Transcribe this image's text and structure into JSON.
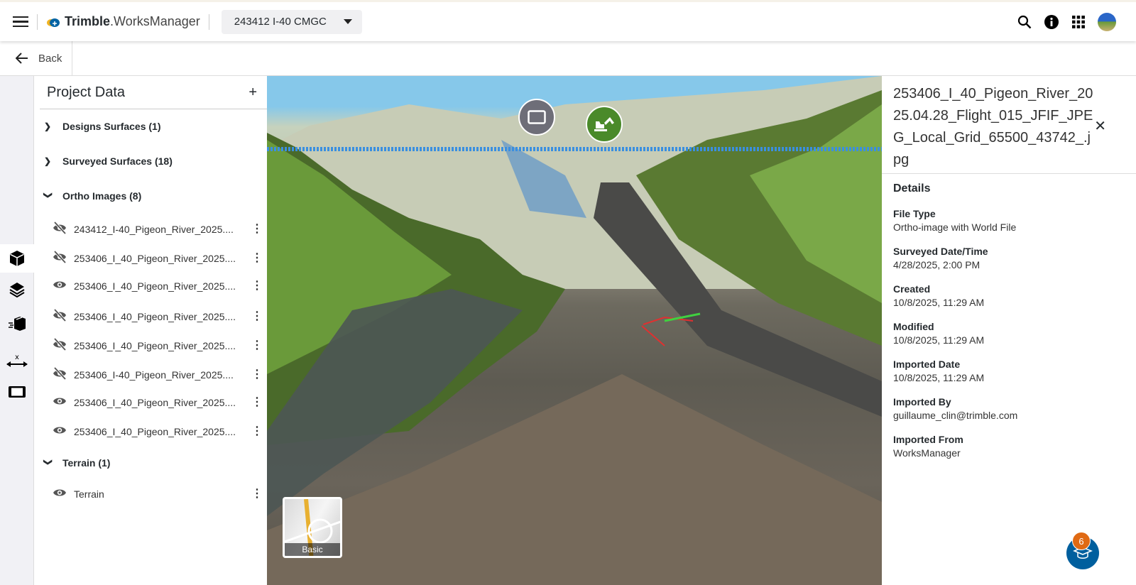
{
  "header": {
    "brand_bold": "Trimble",
    "brand_rest": ".WorksManager",
    "project": "243412 I-40 CMGC"
  },
  "nav": {
    "back": "Back"
  },
  "panel": {
    "title": "Project Data",
    "groups": [
      {
        "label": "Designs Surfaces (1)",
        "expanded": false
      },
      {
        "label": "Surveyed Surfaces (18)",
        "expanded": false
      },
      {
        "label": "Ortho Images (8)",
        "expanded": true
      },
      {
        "label": "Terrain (1)",
        "expanded": true
      }
    ],
    "ortho_items": [
      {
        "label": "243412_I-40_Pigeon_River_2025....",
        "visible": false
      },
      {
        "label": "253406_I_40_Pigeon_River_2025....",
        "visible": false
      },
      {
        "label": "253406_I_40_Pigeon_River_2025....",
        "visible": true
      },
      {
        "label": "253406_I_40_Pigeon_River_2025....",
        "visible": false
      },
      {
        "label": "253406_I_40_Pigeon_River_2025....",
        "visible": false
      },
      {
        "label": "253406_I-40_Pigeon_River_2025....",
        "visible": false
      },
      {
        "label": "253406_I_40_Pigeon_River_2025....",
        "visible": true
      },
      {
        "label": "253406_I_40_Pigeon_River_2025....",
        "visible": true
      }
    ],
    "terrain_items": [
      {
        "label": "Terrain",
        "visible": true
      }
    ]
  },
  "map": {
    "basemap": "Basic"
  },
  "details": {
    "title": "253406_I_40_Pigeon_River_2025.04.28_Flight_015_JFIF_JPEG_Local_Grid_65500_43742_.jpg",
    "heading": "Details",
    "fields": [
      {
        "k": "File Type",
        "v": "Ortho-image with World File"
      },
      {
        "k": "Surveyed Date/Time",
        "v": "4/28/2025, 2:00 PM"
      },
      {
        "k": "Created",
        "v": "10/8/2025, 11:29 AM"
      },
      {
        "k": "Modified",
        "v": "10/8/2025, 11:29 AM"
      },
      {
        "k": "Imported Date",
        "v": "10/8/2025, 11:29 AM"
      },
      {
        "k": "Imported By",
        "v": "guillaume_clin@trimble.com"
      },
      {
        "k": "Imported From",
        "v": "WorksManager"
      }
    ]
  },
  "help": {
    "badge": "6"
  },
  "colors": {
    "accent": "#005f9e",
    "badge": "#e06a14",
    "pin_green": "#4a8a2a",
    "pin_gray": "#6e6e78"
  }
}
